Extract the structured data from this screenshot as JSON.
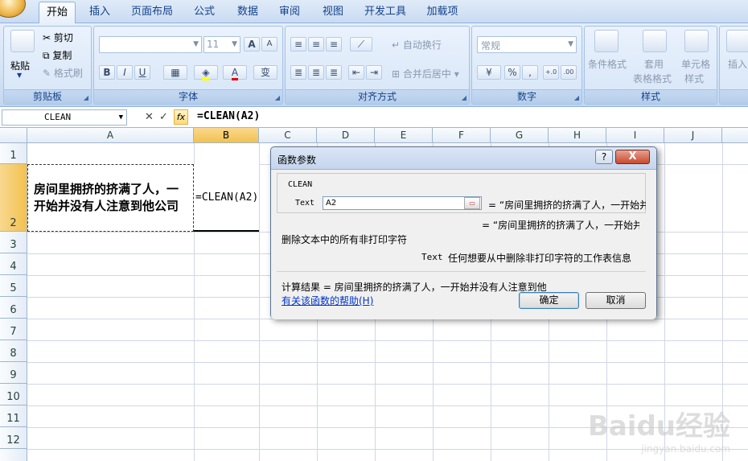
{
  "tabs": [
    {
      "label": "开始",
      "active": true
    },
    {
      "label": "插入",
      "active": false
    },
    {
      "label": "页面布局",
      "active": false
    },
    {
      "label": "公式",
      "active": false
    },
    {
      "label": "数据",
      "active": false
    },
    {
      "label": "审阅",
      "active": false
    },
    {
      "label": "视图",
      "active": false
    },
    {
      "label": "开发工具",
      "active": false
    },
    {
      "label": "加载项",
      "active": false
    }
  ],
  "ribbon": {
    "clipboard": {
      "label": "剪贴板",
      "paste": "粘贴",
      "cut": "剪切",
      "copy": "复制",
      "format_painter": "格式刷"
    },
    "font": {
      "label": "字体",
      "size": "11",
      "bold": "B",
      "italic": "I",
      "underline": "U",
      "grow": "A",
      "shrink": "A",
      "wen": "变"
    },
    "alignment": {
      "label": "对齐方式",
      "wrap_text": "自动换行",
      "merge_center": "合并后居中"
    },
    "number": {
      "label": "数字",
      "format": "常规",
      "percent": "%",
      "comma": ",",
      "inc_decimal": "+.0",
      "dec_decimal": ".00"
    },
    "styles": {
      "label": "样式",
      "conditional": "条件格式",
      "table_1": "套用",
      "table_2": "表格格式",
      "cell_1": "单元格",
      "cell_2": "样式"
    },
    "cells": {
      "insert": "插入"
    }
  },
  "formula_bar": {
    "name_box": "CLEAN",
    "cancel": "✕",
    "enter": "✓",
    "fx": "fx",
    "content": "=CLEAN(A2)"
  },
  "columns": [
    "A",
    "B",
    "C",
    "D",
    "E",
    "F",
    "G",
    "H",
    "I",
    "J"
  ],
  "rows": [
    "1",
    "2",
    "3",
    "4",
    "5",
    "6",
    "7",
    "8",
    "9",
    "10",
    "11",
    "12"
  ],
  "cells": {
    "A2": "房间里拥挤的挤满了人，一开始并没有人注意到他公司",
    "B2": "=CLEAN(A2)"
  },
  "dialog": {
    "title": "函数参数",
    "help_button": "?",
    "close_button": "X",
    "function_name": "CLEAN",
    "arg_name": "Text",
    "arg_value": "A2",
    "arg_result": "= “房间里拥挤的挤满了人，一开始并",
    "result_line": "= “房间里拥挤的挤满了人，一开始并",
    "description": "删除文本中的所有非打印字符",
    "arg_desc_name": "Text",
    "arg_desc": "任何想要从中删除非打印字符的工作表信息",
    "calc_result": "计算结果 =  房间里拥挤的挤满了人，一开始并没有人注意到他",
    "help_link": "有关该函数的帮助(H)",
    "ok": "确定",
    "cancel": "取消"
  },
  "watermark": {
    "main": "Baidu经验",
    "sub": "jingyan.baidu.com"
  }
}
